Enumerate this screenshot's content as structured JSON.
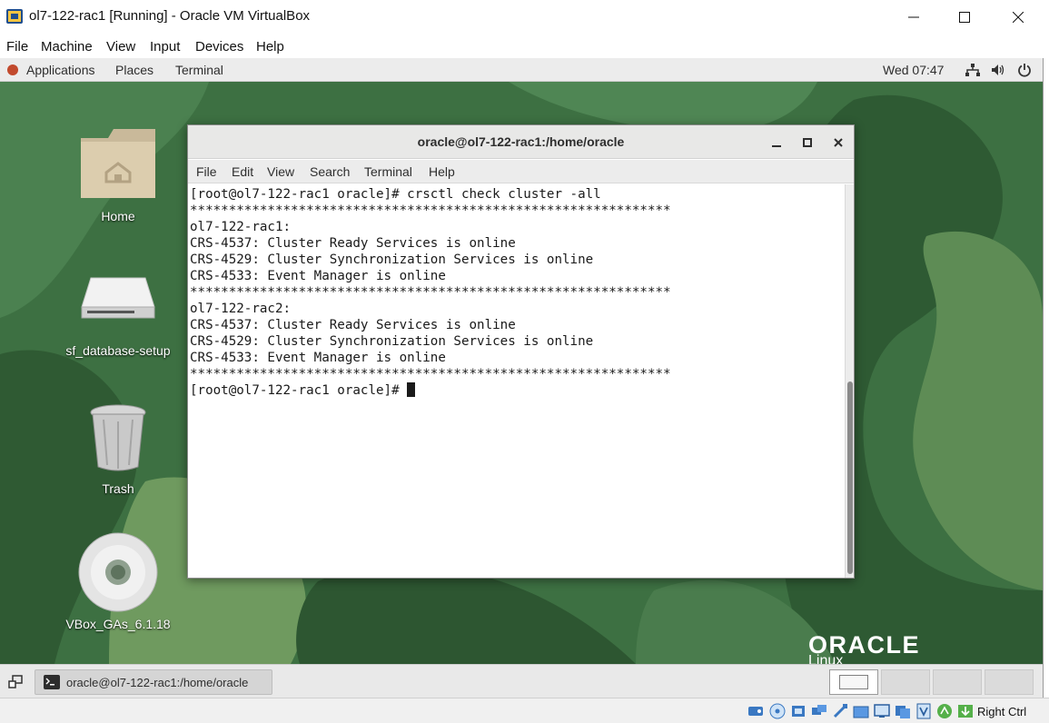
{
  "vbox": {
    "title": "ol7-122-rac1 [Running] - Oracle VM VirtualBox",
    "menu": [
      "File",
      "Machine",
      "View",
      "Input",
      "Devices",
      "Help"
    ],
    "host_key": "Right Ctrl"
  },
  "panel": {
    "applications": "Applications",
    "places": "Places",
    "terminal": "Terminal",
    "clock": "Wed 07:47"
  },
  "desktop": {
    "icons": [
      {
        "label": "Home",
        "icon": "home-folder-icon"
      },
      {
        "label": "sf_database-setup",
        "icon": "drive-icon"
      },
      {
        "label": "Trash",
        "icon": "trash-icon"
      },
      {
        "label": "VBox_GAs_6.1.18",
        "icon": "cd-icon"
      }
    ],
    "brand": "ORACLE",
    "brand_sub": "Linux"
  },
  "terminal": {
    "title": "oracle@ol7-122-rac1:/home/oracle",
    "menu": [
      "File",
      "Edit",
      "View",
      "Search",
      "Terminal",
      "Help"
    ],
    "lines": [
      "[root@ol7-122-rac1 oracle]# crsctl check cluster -all",
      "**************************************************************",
      "ol7-122-rac1:",
      "CRS-4537: Cluster Ready Services is online",
      "CRS-4529: Cluster Synchronization Services is online",
      "CRS-4533: Event Manager is online",
      "**************************************************************",
      "ol7-122-rac2:",
      "CRS-4537: Cluster Ready Services is online",
      "CRS-4529: Cluster Synchronization Services is online",
      "CRS-4533: Event Manager is online",
      "**************************************************************"
    ],
    "prompt": "[root@ol7-122-rac1 oracle]# "
  },
  "taskbar": {
    "task_label": "oracle@ol7-122-rac1:/home/oracle"
  },
  "colors": {
    "desktop_green": "#3c6e3e",
    "panel_bg": "#ececec"
  }
}
